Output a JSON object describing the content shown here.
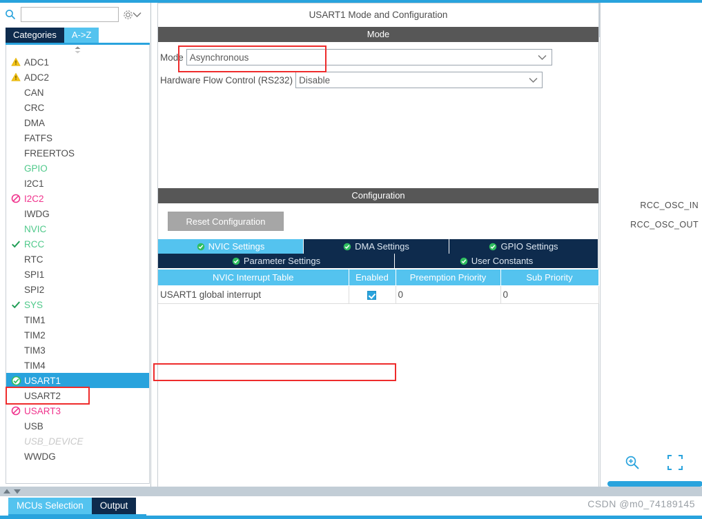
{
  "window": {
    "title": "USART1 Mode and Configuration"
  },
  "sidebar": {
    "search": {
      "value": "",
      "placeholder": ""
    },
    "icons": {
      "search": "search-icon",
      "chevron": "chevron-down-icon",
      "gear": "gear-icon",
      "scroll_grip": "scroll-grip-icon"
    },
    "tabs": [
      {
        "label": "Categories",
        "active": false
      },
      {
        "label": "A->Z",
        "active": true
      }
    ],
    "items": [
      {
        "label": "ADC1",
        "status": "warning",
        "color": "#4d4d4d"
      },
      {
        "label": "ADC2",
        "status": "warning",
        "color": "#4d4d4d"
      },
      {
        "label": "CAN",
        "status": "none",
        "color": "#4d4d4d"
      },
      {
        "label": "CRC",
        "status": "none",
        "color": "#4d4d4d"
      },
      {
        "label": "DMA",
        "status": "none",
        "color": "#4d4d4d"
      },
      {
        "label": "FATFS",
        "status": "none",
        "color": "#4d4d4d"
      },
      {
        "label": "FREERTOS",
        "status": "none",
        "color": "#4d4d4d"
      },
      {
        "label": "GPIO",
        "status": "none",
        "color": "#4fc98a"
      },
      {
        "label": "I2C1",
        "status": "none",
        "color": "#4d4d4d"
      },
      {
        "label": "I2C2",
        "status": "blocked",
        "color": "#f0328c"
      },
      {
        "label": "IWDG",
        "status": "none",
        "color": "#4d4d4d"
      },
      {
        "label": "NVIC",
        "status": "none",
        "color": "#4fc98a"
      },
      {
        "label": "RCC",
        "status": "check",
        "color": "#4fc98a"
      },
      {
        "label": "RTC",
        "status": "none",
        "color": "#4d4d4d"
      },
      {
        "label": "SPI1",
        "status": "none",
        "color": "#4d4d4d"
      },
      {
        "label": "SPI2",
        "status": "none",
        "color": "#4d4d4d"
      },
      {
        "label": "SYS",
        "status": "check",
        "color": "#4fc98a"
      },
      {
        "label": "TIM1",
        "status": "none",
        "color": "#4d4d4d"
      },
      {
        "label": "TIM2",
        "status": "none",
        "color": "#4d4d4d"
      },
      {
        "label": "TIM3",
        "status": "none",
        "color": "#4d4d4d"
      },
      {
        "label": "TIM4",
        "status": "none",
        "color": "#4d4d4d"
      },
      {
        "label": "USART1",
        "status": "ok-circle",
        "color": "#ffffff",
        "selected": true
      },
      {
        "label": "USART2",
        "status": "none",
        "color": "#4d4d4d"
      },
      {
        "label": "USART3",
        "status": "blocked",
        "color": "#f0328c"
      },
      {
        "label": "USB",
        "status": "none",
        "color": "#4d4d4d"
      },
      {
        "label": "USB_DEVICE",
        "status": "none",
        "color": "#c8c8c8"
      },
      {
        "label": "WWDG",
        "status": "none",
        "color": "#4d4d4d"
      }
    ]
  },
  "mode_section": {
    "header": "Mode",
    "fields": [
      {
        "label": "Mode",
        "value": "Asynchronous"
      },
      {
        "label": "Hardware Flow Control (RS232)",
        "value": "Disable"
      }
    ]
  },
  "configuration": {
    "header": "Configuration",
    "reset_button": "Reset Configuration",
    "tabs_row1": [
      {
        "label": "NVIC Settings",
        "active": true
      },
      {
        "label": "DMA Settings",
        "active": false
      },
      {
        "label": "GPIO Settings",
        "active": false
      }
    ],
    "tabs_row2": [
      {
        "label": "Parameter Settings",
        "active": false
      },
      {
        "label": "User Constants",
        "active": false
      }
    ],
    "table": {
      "columns": [
        "NVIC Interrupt Table",
        "Enabled",
        "Preemption Priority",
        "Sub Priority"
      ],
      "rows": [
        {
          "name": "USART1 global interrupt",
          "enabled": true,
          "preemption": "0",
          "sub": "0"
        }
      ]
    }
  },
  "chip_panel": {
    "pin_labels": [
      "RCC_OSC_IN",
      "RCC_OSC_OUT"
    ],
    "icons": {
      "zoom_in": "zoom-in-icon",
      "fit": "fit-to-screen-icon"
    }
  },
  "bottom": {
    "tabs": [
      {
        "label": "MCUs Selection",
        "active": true
      },
      {
        "label": "Output",
        "active": false
      }
    ],
    "watermark": "CSDN @m0_74189145"
  },
  "annotations": {
    "count": 3,
    "color": "#ee2b2b"
  }
}
